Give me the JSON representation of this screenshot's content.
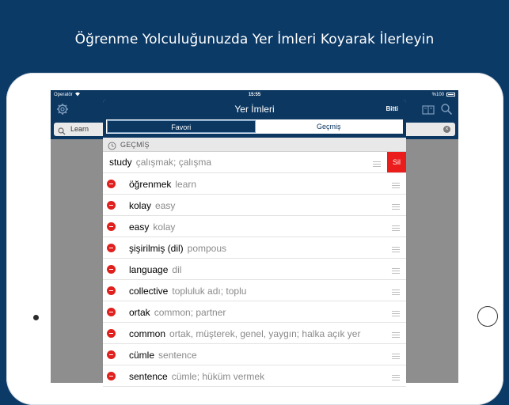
{
  "headline": "Öğrenme Yolculuğunuzda Yer İmleri Koyarak İlerleyin",
  "status_bar": {
    "carrier": "Operatör",
    "time": "15:55",
    "battery": "%100"
  },
  "search": {
    "value": "Learn"
  },
  "modal": {
    "title": "Yer İmleri",
    "done_label": "Bitti",
    "tabs": [
      {
        "label": "Favori",
        "active": true
      },
      {
        "label": "Geçmiş",
        "active": false
      }
    ],
    "section_label": "GEÇMİŞ",
    "delete_label": "Sil",
    "entries": [
      {
        "term": "study",
        "translation": "çalışmak; çalışma"
      },
      {
        "term": "öğrenmek",
        "translation": "learn"
      },
      {
        "term": "kolay",
        "translation": "easy"
      },
      {
        "term": "easy",
        "translation": "kolay"
      },
      {
        "term": "şişirilmiş (dil)",
        "translation": "pompous"
      },
      {
        "term": "language",
        "translation": "dil"
      },
      {
        "term": "collective",
        "translation": "topluluk adı; toplu"
      },
      {
        "term": "ortak",
        "translation": "common; partner"
      },
      {
        "term": "common",
        "translation": "ortak, müşterek, genel, yaygın; halka açık yer"
      },
      {
        "term": "cümle",
        "translation": "sentence"
      },
      {
        "term": "sentence",
        "translation": "cümle; hüküm vermek"
      }
    ]
  },
  "colors": {
    "brand_navy": "#0b3761",
    "delete_red": "#ea1c1c",
    "minus_red": "#e0201d"
  },
  "icons": [
    "gear-icon",
    "wifi-icon",
    "battery-icon",
    "book-icon",
    "search-icon",
    "clear-icon",
    "clock-icon",
    "minus-icon",
    "drag-handle-icon"
  ]
}
